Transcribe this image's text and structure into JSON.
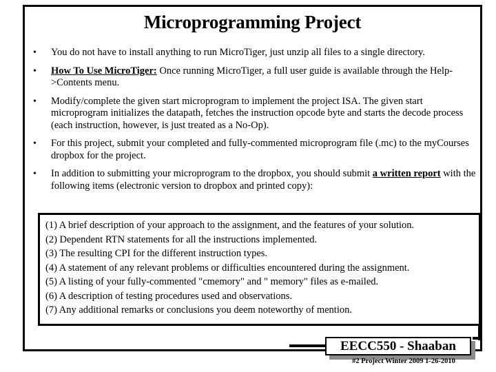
{
  "slide": {
    "title": "Microprogramming Project",
    "bullet_marker": "•",
    "bullets": [
      {
        "id": "install-note",
        "segments": [
          {
            "style": "normal",
            "text": "You do not have to install anything to run MicroTiger, just unzip all files to a single directory."
          }
        ]
      },
      {
        "id": "how-to-use",
        "segments": [
          {
            "style": "bold-underline",
            "text": "How To Use MicroTiger:"
          },
          {
            "style": "normal",
            "text": "  Once running MicroTiger, a full user guide is available through the Help->Contents menu."
          }
        ]
      },
      {
        "id": "modify-microprogram",
        "segments": [
          {
            "style": "normal",
            "text": "Modify/complete the given start microprogram to implement the project ISA.  The given start microprogram initializes  the datapath, fetches the instruction  opcode byte and starts the decode process (each instruction, however,  is just treated as a No-Op)."
          }
        ]
      },
      {
        "id": "submit-microprogram",
        "segments": [
          {
            "style": "normal",
            "text": "For this project, submit your completed and fully-commented microprogram file (.mc) to the myCourses dropbox for the project."
          }
        ]
      },
      {
        "id": "written-report",
        "segments": [
          {
            "style": "normal",
            "text": "In addition to submitting your microprogram to the dropbox, you should submit "
          },
          {
            "style": "bold-underline",
            "text": "a written report"
          },
          {
            "style": "normal",
            "text": " with the following items (electronic version to dropbox and printed copy):"
          }
        ]
      }
    ],
    "requirements": [
      "(1) A brief description of your approach to the assignment, and the features of your solution.",
      "(2)  Dependent RTN statements for all the instructions implemented.",
      "(3)  The resulting CPI for the different instruction types.",
      "(4) A statement of any relevant problems or difficulties encountered during the assignment.",
      "(5) A listing of your fully-commented  \"cmemory\" and \" memory\" files as e-mailed.",
      "(6) A description of testing procedures used and observations.",
      "(7) Any additional remarks or conclusions you deem noteworthy of mention."
    ],
    "footer": {
      "badge_label": "EECC550 - Shaaban",
      "subtitle": "#2   Project  Winter 2009  1-26-2010"
    },
    "colors": {
      "text": "#000000",
      "background": "#ffffff",
      "border": "#000000",
      "badge_shadow": "#8c8c8c"
    }
  }
}
